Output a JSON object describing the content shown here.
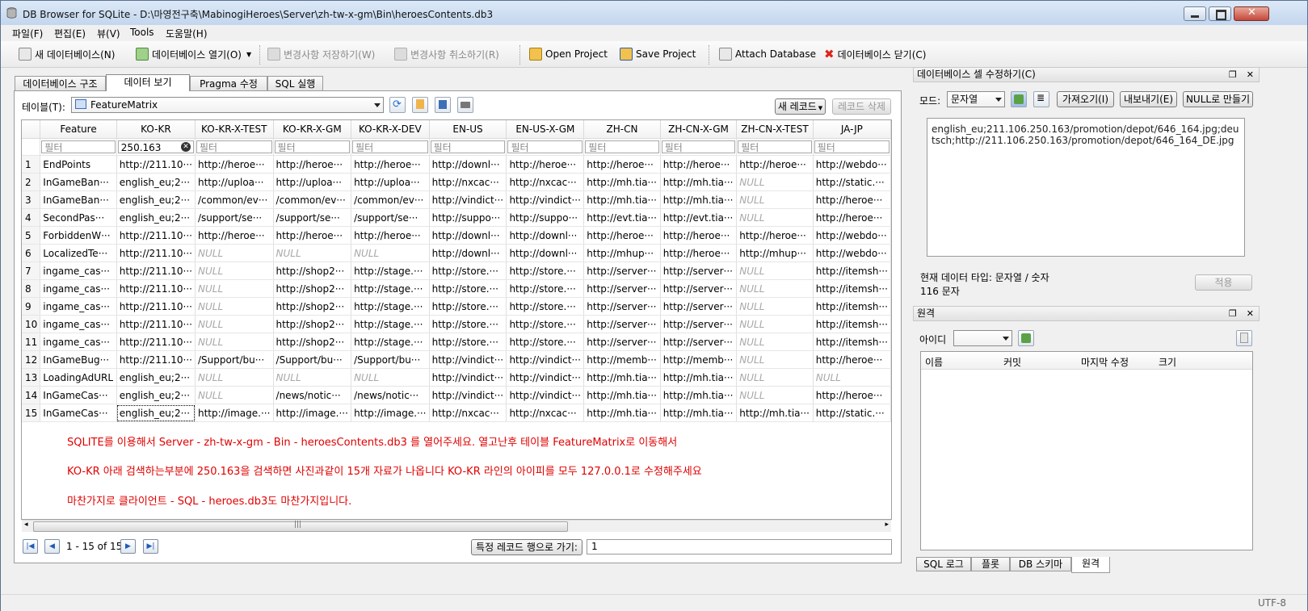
{
  "window": {
    "title": "DB Browser for SQLite - D:\\마영전구축\\MabinogiHeroes\\Server\\zh-tw-x-gm\\Bin\\heroesContents.db3"
  },
  "menu": [
    "파일(F)",
    "편집(E)",
    "뷰(V)",
    "Tools",
    "도움말(H)"
  ],
  "toolbar": {
    "new_db": "새 데이터베이스(N)",
    "open_db": "데이터베이스 열기(O)",
    "write_changes": "변경사항 저장하기(W)",
    "revert_changes": "변경사항 취소하기(R)",
    "open_project": "Open Project",
    "save_project": "Save Project",
    "attach_db": "Attach Database",
    "close_db": "데이터베이스 닫기(C)"
  },
  "tabs": [
    "데이터베이스 구조",
    "데이터 보기",
    "Pragma 수정",
    "SQL 실행"
  ],
  "browse": {
    "table_label": "테이블(T):",
    "table_name": "FeatureMatrix",
    "new_record": "새 레코드",
    "delete_record": "레코드 삭제",
    "columns": [
      "Feature",
      "KO-KR",
      "KO-KR-X-TEST",
      "KO-KR-X-GM",
      "KO-KR-X-DEV",
      "EN-US",
      "EN-US-X-GM",
      "ZH-CN",
      "ZH-CN-X-GM",
      "ZH-CN-X-TEST",
      "JA-JP"
    ],
    "filter_placeholder": "필터",
    "filter_value": "250.163",
    "rows": [
      [
        "1",
        "EndPoints",
        "http://211.10···",
        "http://heroe···",
        "http://heroe···",
        "http://heroe···",
        "http://downl···",
        "http://heroe···",
        "http://heroe···",
        "http://heroe···",
        "http://heroe···",
        "http://webdo···"
      ],
      [
        "2",
        "InGameBan···",
        "english_eu;2···",
        "http://uploa···",
        "http://uploa···",
        "http://uploa···",
        "http://nxcac···",
        "http://nxcac···",
        "http://mh.tia···",
        "http://mh.tia···",
        "NULL",
        "http://static.···"
      ],
      [
        "3",
        "InGameBan···",
        "english_eu;2···",
        "/common/ev···",
        "/common/ev···",
        "/common/ev···",
        "http://vindict···",
        "http://vindict···",
        "http://mh.tia···",
        "http://mh.tia···",
        "NULL",
        "http://heroe···"
      ],
      [
        "4",
        "SecondPas···",
        "english_eu;2···",
        "/support/se···",
        "/support/se···",
        "/support/se···",
        "http://suppo···",
        "http://suppo···",
        "http://evt.tia···",
        "http://evt.tia···",
        "NULL",
        "http://heroe···"
      ],
      [
        "5",
        "ForbiddenW···",
        "http://211.10···",
        "http://heroe···",
        "http://heroe···",
        "http://heroe···",
        "http://downl···",
        "http://downl···",
        "http://heroe···",
        "http://heroe···",
        "http://heroe···",
        "http://webdo···"
      ],
      [
        "6",
        "LocalizedTe···",
        "http://211.10···",
        "NULL",
        "NULL",
        "NULL",
        "http://downl···",
        "http://downl···",
        "http://mhup···",
        "http://heroe···",
        "http://mhup···",
        "http://webdo···"
      ],
      [
        "7",
        "ingame_cas···",
        "http://211.10···",
        "NULL",
        "http://shop2···",
        "http://stage.···",
        "http://store.···",
        "http://store.···",
        "http://server···",
        "http://server···",
        "NULL",
        "http://itemsh···"
      ],
      [
        "8",
        "ingame_cas···",
        "http://211.10···",
        "NULL",
        "http://shop2···",
        "http://stage.···",
        "http://store.···",
        "http://store.···",
        "http://server···",
        "http://server···",
        "NULL",
        "http://itemsh···"
      ],
      [
        "9",
        "ingame_cas···",
        "http://211.10···",
        "NULL",
        "http://shop2···",
        "http://stage.···",
        "http://store.···",
        "http://store.···",
        "http://server···",
        "http://server···",
        "NULL",
        "http://itemsh···"
      ],
      [
        "10",
        "ingame_cas···",
        "http://211.10···",
        "NULL",
        "http://shop2···",
        "http://stage.···",
        "http://store.···",
        "http://store.···",
        "http://server···",
        "http://server···",
        "NULL",
        "http://itemsh···"
      ],
      [
        "11",
        "ingame_cas···",
        "http://211.10···",
        "NULL",
        "http://shop2···",
        "http://stage.···",
        "http://store.···",
        "http://store.···",
        "http://server···",
        "http://server···",
        "NULL",
        "http://itemsh···"
      ],
      [
        "12",
        "InGameBug···",
        "http://211.10···",
        "/Support/bu···",
        "/Support/bu···",
        "/Support/bu···",
        "http://vindict···",
        "http://vindict···",
        "http://memb···",
        "http://memb···",
        "NULL",
        "http://heroe···"
      ],
      [
        "13",
        "LoadingAdURL",
        "english_eu;2···",
        "NULL",
        "NULL",
        "NULL",
        "http://vindict···",
        "http://vindict···",
        "http://mh.tia···",
        "http://mh.tia···",
        "NULL",
        "NULL"
      ],
      [
        "14",
        "InGameCas···",
        "english_eu;2···",
        "NULL",
        "/news/notic···",
        "/news/notic···",
        "http://vindict···",
        "http://vindict···",
        "http://mh.tia···",
        "http://mh.tia···",
        "NULL",
        "http://heroe···"
      ],
      [
        "15",
        "InGameCas···",
        "english_eu;2···",
        "http://image.···",
        "http://image.···",
        "http://image.···",
        "http://nxcac···",
        "http://nxcac···",
        "http://mh.tia···",
        "http://mh.tia···",
        "http://mh.tia···",
        "http://static.···"
      ]
    ],
    "notes": [
      "SQLITE를 이용해서 Server - zh-tw-x-gm - Bin - heroesContents.db3 를 열어주세요. 열고난후 테이블 FeatureMatrix로 이동해서",
      "KO-KR 아래 검색하는부분에 250.163을 검색하면 사진과같이 15개 자료가 나옵니다 KO-KR 라인의 아이피를 모두 127.0.0.1로 수정해주세요",
      "마찬가지로 클라이언트 - SQL - heroes.db3도 마찬가지입니다."
    ],
    "pager": "1 - 15 of 15",
    "goto_label": "특정 레코드 행으로 가기:",
    "goto_value": "1"
  },
  "edit_cell": {
    "title": "데이터베이스 셀 수정하기(C)",
    "mode_label": "모드:",
    "mode_value": "문자열",
    "import": "가져오기(I)",
    "export": "내보내기(E)",
    "set_null": "NULL로 만들기",
    "content": "english_eu;211.106.250.163/promotion/depot/646_164.jpg;deutsch;http://211.106.250.163/promotion/depot/646_164_DE.jpg",
    "type_info": "현재 데이터 타입: 문자열 / 숫자",
    "size_info": "116 문자",
    "apply": "적용"
  },
  "remote": {
    "title": "원격",
    "id_label": "아이디",
    "columns": [
      "이름",
      "커밋",
      "마지막 수정",
      "크기"
    ]
  },
  "bottom_tabs": [
    "SQL 로그",
    "플롯",
    "DB 스키마",
    "원격"
  ],
  "status": {
    "encoding": "UTF-8"
  },
  "colors": {
    "note_red": "#e10000",
    "title_grad": "#c3d6ee"
  }
}
